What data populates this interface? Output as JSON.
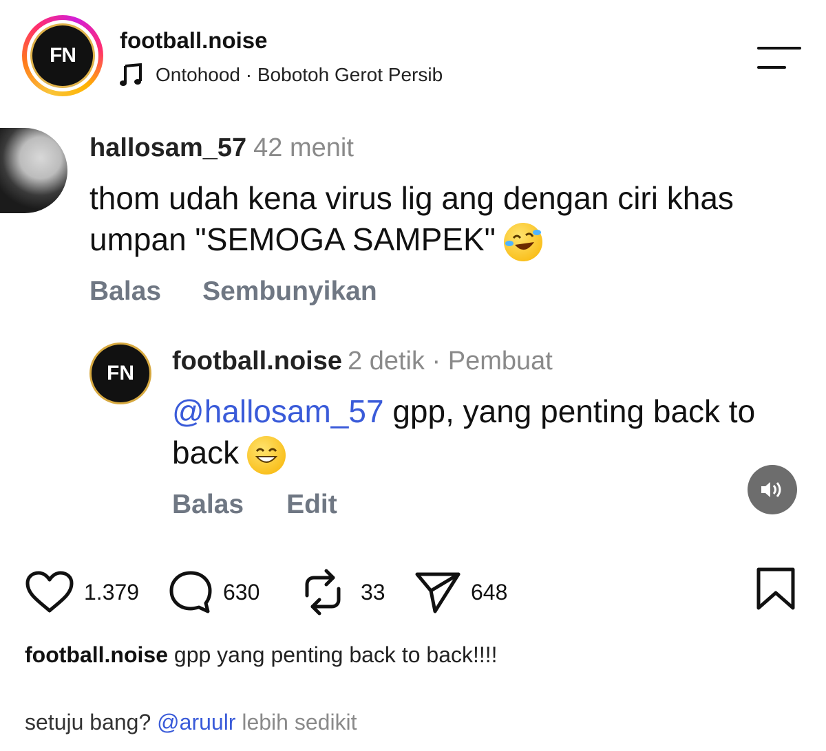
{
  "header": {
    "account_name": "football.noise",
    "avatar_initials": "FN",
    "music": "Ontohood · Bobotoh Gerot Persib",
    "icons": [
      "music-note-icon",
      "menu-icon"
    ]
  },
  "comment": {
    "username": "hallosam_57",
    "time": "42 menit",
    "text": "thom udah kena virus lig ang dengan ciri khas umpan \"SEMOGA SAMPEK\"",
    "emoji": "rofl-emoji",
    "actions": {
      "reply": "Balas",
      "hide": "Sembunyikan"
    }
  },
  "reply": {
    "username": "football.noise",
    "avatar_initials": "FN",
    "meta": "2 detik · Pembuat",
    "mention": "@hallosam_57",
    "text": " gpp, yang penting back to back",
    "emoji": "grin-emoji",
    "actions": {
      "reply": "Balas",
      "edit": "Edit"
    }
  },
  "stats": {
    "likes": "1.379",
    "comments": "630",
    "reposts": "33",
    "shares": "648"
  },
  "caption": {
    "username": "football.noise",
    "text": "gpp yang penting back to back!!!!"
  },
  "subline": {
    "prefix": "setuju bang?",
    "mention": "@aruulr",
    "more": "lebih sedikit"
  },
  "colors": {
    "mention": "#3a5bd9",
    "muted": "#8a8a8a",
    "action": "#6f7783"
  }
}
